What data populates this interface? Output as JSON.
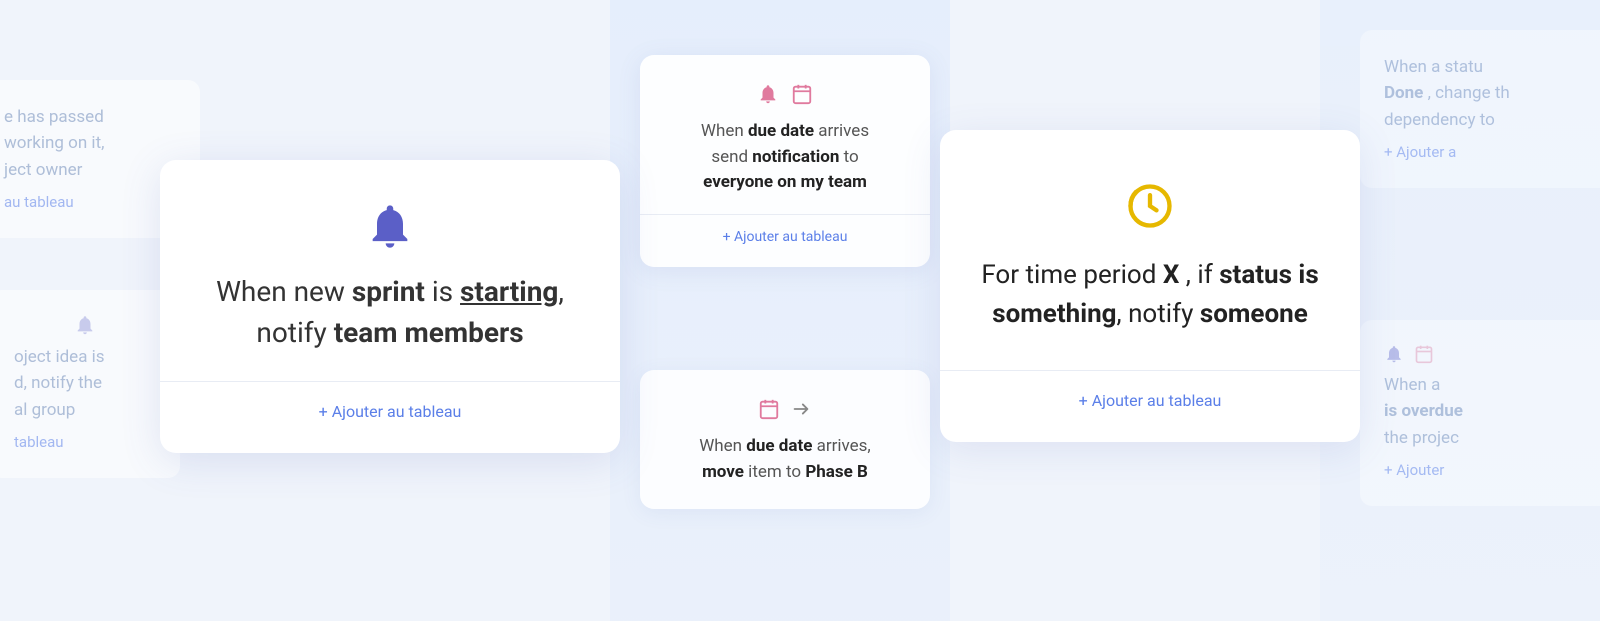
{
  "colors": {
    "bell_purple": "#5b5fc7",
    "calendar_pink": "#e07a9e",
    "clock_yellow": "#e6b800",
    "link_blue": "#5b7fe8",
    "text_dark": "#222222",
    "text_mid": "#555555",
    "text_ghost": "rgba(100,130,180,0.5)"
  },
  "ghost_left": {
    "line1": "e has passed",
    "line2": "working on it,",
    "line3": "ject owner",
    "link": "au tableau"
  },
  "ghost_left_bottom": {
    "line1": "oject idea is",
    "line2": "d, notify the",
    "line3": "al group",
    "bell_visible": true,
    "link": "tableau"
  },
  "card_sprint": {
    "text_before": "When new ",
    "text_bold1": "sprint",
    "text_mid": " is ",
    "text_underline": "starting",
    "text_after": ", notify ",
    "text_bold2": "team members",
    "add_label": "+ Ajouter au tableau"
  },
  "card_due_date_notify": {
    "text_when": "When ",
    "text_bold": "due date",
    "text_arrives": " arrives",
    "text_send": "send ",
    "text_bold2": "notification",
    "text_to": " to",
    "text_bold3": "everyone on my team",
    "add_label": "+ Ajouter au tableau"
  },
  "card_due_date_move": {
    "text_when": "When ",
    "text_bold": "due date",
    "text_arrives": " arrives,",
    "text_move": "move",
    "text_item": " item to ",
    "text_bold2": "Phase B",
    "add_label": "+ Ajouter au tableau"
  },
  "card_time_period": {
    "text1": "For time period ",
    "bold1": "X",
    "text2": " , if ",
    "bold2": "status is something",
    "text3": ", notify ",
    "bold3": "someone",
    "add_label": "+ Ajouter au tableau"
  },
  "ghost_right": {
    "line1": "When a statu",
    "line2": "Done",
    "line3": ", change th",
    "line4": "dependency to",
    "link": "+ Ajouter a"
  },
  "ghost_right_bottom": {
    "line1": "When a",
    "line2": "is overdue",
    "line3": "the projec",
    "link": "+ Ajouter"
  }
}
